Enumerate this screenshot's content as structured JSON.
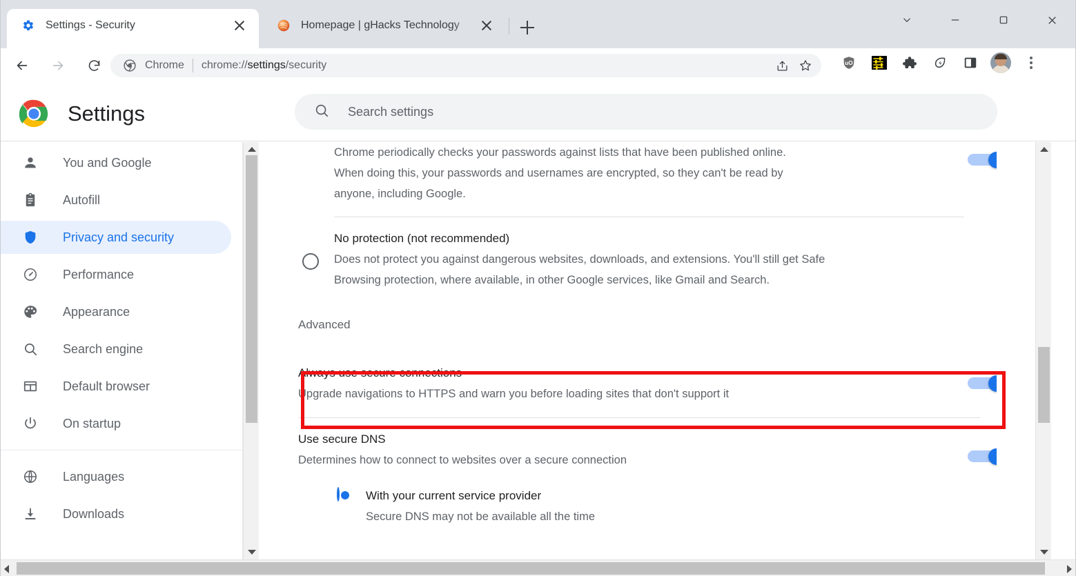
{
  "window": {
    "controls": [
      {
        "name": "tab-search",
        "icon": "chevron-down-icon"
      },
      {
        "name": "minimize",
        "icon": "minimize-icon"
      },
      {
        "name": "maximize",
        "icon": "maximize-icon"
      },
      {
        "name": "close",
        "icon": "close-icon"
      }
    ]
  },
  "tabs": [
    {
      "title": "Settings - Security",
      "favicon": "gear-icon",
      "active": true
    },
    {
      "title": "Homepage | gHacks Technology",
      "favicon": "ghacks-icon",
      "active": false
    }
  ],
  "new_tab_label": "+",
  "toolbar": {
    "back_icon": "arrow-back-icon",
    "forward_icon": "arrow-forward-icon",
    "reload_icon": "reload-icon",
    "omnibox": {
      "site_icon": "chrome-icon",
      "site_label": "Chrome",
      "url_prefix": "chrome://",
      "url_domain": "settings",
      "url_suffix": "/security",
      "full_url": "chrome://settings/security"
    },
    "actions": [
      {
        "name": "share-icon"
      },
      {
        "name": "bookmark-star-icon"
      }
    ],
    "extensions": [
      {
        "name": "ublock-origin-icon",
        "title": "uBlock Origin"
      },
      {
        "name": "yellow-list-extension-icon",
        "title": "Extension"
      },
      {
        "name": "puzzle-extensions-icon",
        "title": "Extensions"
      },
      {
        "name": "leaf-bolt-extension-icon",
        "title": "Extension"
      },
      {
        "name": "side-panel-icon",
        "title": "Side panel"
      }
    ],
    "avatar_name": "profile-avatar",
    "menu_name": "chrome-menu-icon"
  },
  "settings": {
    "logo": "chrome-logo",
    "title": "Settings",
    "search": {
      "placeholder": "Search settings",
      "value": "",
      "icon": "search-icon"
    }
  },
  "sidebar": {
    "groups": [
      {
        "items": [
          {
            "label": "You and Google",
            "icon": "person-icon",
            "selected": false
          },
          {
            "label": "Autofill",
            "icon": "clipboard-icon",
            "selected": false
          },
          {
            "label": "Privacy and security",
            "icon": "shield-icon",
            "selected": true
          },
          {
            "label": "Performance",
            "icon": "speedometer-icon",
            "selected": false
          },
          {
            "label": "Appearance",
            "icon": "palette-icon",
            "selected": false
          },
          {
            "label": "Search engine",
            "icon": "search-icon",
            "selected": false
          },
          {
            "label": "Default browser",
            "icon": "browser-window-icon",
            "selected": false
          },
          {
            "label": "On startup",
            "icon": "power-icon",
            "selected": false
          }
        ]
      },
      {
        "items": [
          {
            "label": "Languages",
            "icon": "globe-icon",
            "selected": false
          },
          {
            "label": "Downloads",
            "icon": "download-icon",
            "selected": false
          }
        ]
      }
    ]
  },
  "main": {
    "password_check": {
      "description_l1": "Chrome periodically checks your passwords against lists that have been published online.",
      "description_l2": "When doing this, your passwords and usernames are encrypted, so they can't be read by",
      "description_l3": "anyone, including Google.",
      "toggle_on": true
    },
    "no_protection": {
      "title": "No protection (not recommended)",
      "description_l1": "Does not protect you against dangerous websites, downloads, and extensions. You'll still get Safe",
      "description_l2": "Browsing protection, where available, in other Google services, like Gmail and Search.",
      "selected": false
    },
    "advanced_label": "Advanced",
    "secure_connections": {
      "title": "Always use secure connections",
      "description": "Upgrade navigations to HTTPS and warn you before loading sites that don't support it",
      "toggle_on": true,
      "focused": true,
      "highlighted": true,
      "highlight_color": "#ee1111"
    },
    "secure_dns": {
      "title": "Use secure DNS",
      "description": "Determines how to connect to websites over a secure connection",
      "toggle_on": true,
      "options": [
        {
          "label": "With your current service provider",
          "description": "Secure DNS may not be available all the time",
          "selected": true
        }
      ]
    }
  },
  "colors": {
    "accent": "#1a73e8",
    "accent_light": "#aecbfa",
    "focus_ring": "#d2e3fc",
    "selected_bg": "#e8f0fe",
    "text_primary": "#202124",
    "text_secondary": "#5f6368",
    "tabstrip_bg": "#dee1e6",
    "highlight_red": "#ee1111"
  }
}
